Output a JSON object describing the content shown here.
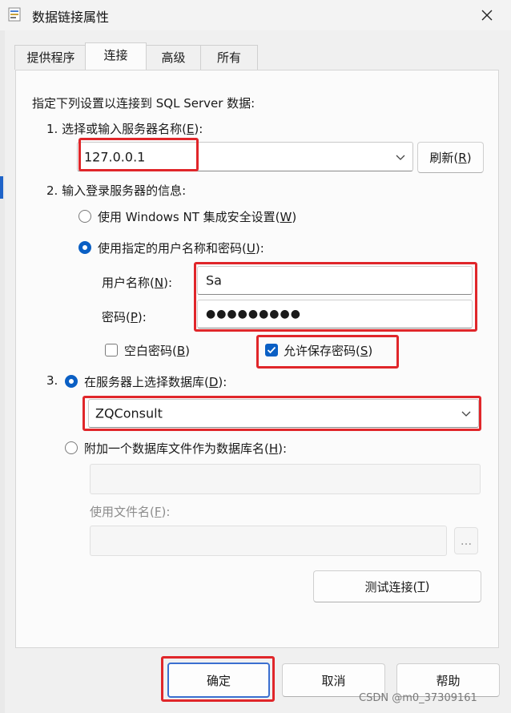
{
  "window": {
    "title": "数据链接属性"
  },
  "tabs": [
    {
      "label": "提供程序"
    },
    {
      "label": "连接"
    },
    {
      "label": "高级"
    },
    {
      "label": "所有"
    }
  ],
  "connection": {
    "intro": "指定下列设置以连接到 SQL Server 数据:",
    "step1": {
      "label_pre": "1. 选择或输入服务器名称(",
      "key": "E",
      "label_post": "):",
      "server_value": "127.0.0.1",
      "refresh_pre": "刷新(",
      "refresh_key": "R",
      "refresh_post": ")"
    },
    "step2": {
      "label": "2. 输入登录服务器的信息:",
      "radio_nt": {
        "pre": "使用 Windows NT 集成安全设置(",
        "key": "W",
        "post": ")",
        "checked": false
      },
      "radio_user": {
        "pre": "使用指定的用户名称和密码(",
        "key": "U",
        "post": "):",
        "checked": true
      },
      "username_label": {
        "pre": "用户名称(",
        "key": "N",
        "post": "):"
      },
      "username_value": "Sa",
      "password_label": {
        "pre": "密码(",
        "key": "P",
        "post": "):"
      },
      "password_value": "●●●●●●●●●",
      "blank_pwd": {
        "pre": "空白密码(",
        "key": "B",
        "post": ")",
        "checked": false
      },
      "allow_save": {
        "pre": "允许保存密码(",
        "key": "S",
        "post": ")",
        "checked": true
      }
    },
    "step3": {
      "num": "3.",
      "radio_db": {
        "pre": "在服务器上选择数据库(",
        "key": "D",
        "post": "):",
        "checked": true
      },
      "database_value": "ZQConsult",
      "radio_attach": {
        "pre": "附加一个数据库文件作为数据库名(",
        "key": "H",
        "post": "):",
        "checked": false
      },
      "filename_label": {
        "pre": "使用文件名(",
        "key": "F",
        "post": "):"
      },
      "browse_label": "..."
    },
    "test_button": {
      "pre": "测试连接(",
      "key": "T",
      "post": ")"
    }
  },
  "footer": {
    "ok": "确定",
    "cancel": "取消",
    "help": "帮助"
  },
  "watermark": "CSDN @m0_37309161",
  "colors": {
    "accent": "#0a5fc4",
    "highlight": "#e0262a"
  }
}
